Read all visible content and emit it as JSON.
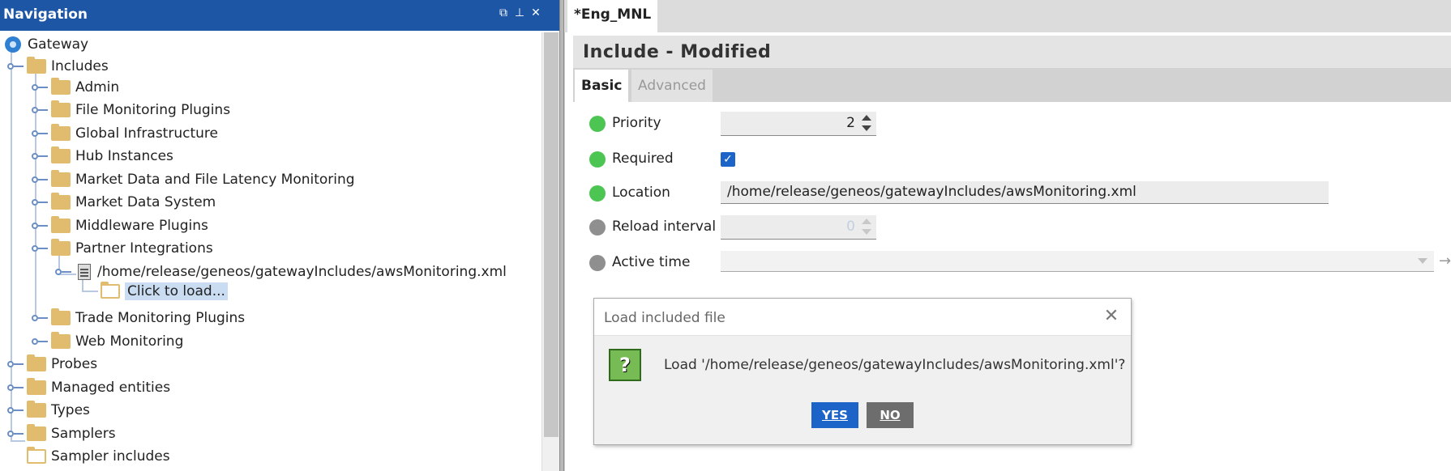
{
  "navigation": {
    "title": "Navigation",
    "controls": [
      "restore-icon",
      "pin-icon",
      "close-icon"
    ]
  },
  "tree": {
    "root": "Gateway",
    "includes": "Includes",
    "include_children": [
      "Admin",
      "File Monitoring Plugins",
      "Global Infrastructure",
      "Hub Instances",
      "Market Data and File Latency Monitoring",
      "Market Data System",
      "Middleware Plugins",
      "Partner Integrations"
    ],
    "partner_file": "/home/release/geneos/gatewayIncludes/awsMonitoring.xml",
    "click_to_load": "Click to load...",
    "include_children_after": [
      "Trade Monitoring Plugins",
      "Web Monitoring"
    ],
    "top_level": [
      "Probes",
      "Managed entities",
      "Types",
      "Samplers"
    ],
    "sampler_includes": "Sampler includes"
  },
  "editor": {
    "tab_label": "*Eng_MNL",
    "title": "Include - Modified",
    "tabs": [
      "Basic",
      "Advanced"
    ],
    "fields": {
      "priority": {
        "label": "Priority",
        "value": "2",
        "status_color": "#4cc552"
      },
      "required": {
        "label": "Required",
        "checked": true,
        "status_color": "#4cc552"
      },
      "location": {
        "label": "Location",
        "value": "/home/release/geneos/gatewayIncludes/awsMonitoring.xml",
        "status_color": "#4cc552"
      },
      "reload_interval": {
        "label": "Reload interval",
        "value": "0",
        "status_color": "#8f8f8f"
      },
      "active_time": {
        "label": "Active time",
        "value": "",
        "status_color": "#8f8f8f"
      }
    }
  },
  "dialog": {
    "title": "Load included file",
    "message": "Load '/home/release/geneos/gatewayIncludes/awsMonitoring.xml'?",
    "yes_label": "YES",
    "no_label": "NO",
    "icon_glyph": "?"
  },
  "colors": {
    "nav_titlebar": "#1d56a5",
    "folder": "#e2bc6e",
    "status_green": "#4cc552",
    "status_grey": "#8f8f8f",
    "primary_button": "#1d64c8",
    "secondary_button": "#6d6d6d"
  }
}
